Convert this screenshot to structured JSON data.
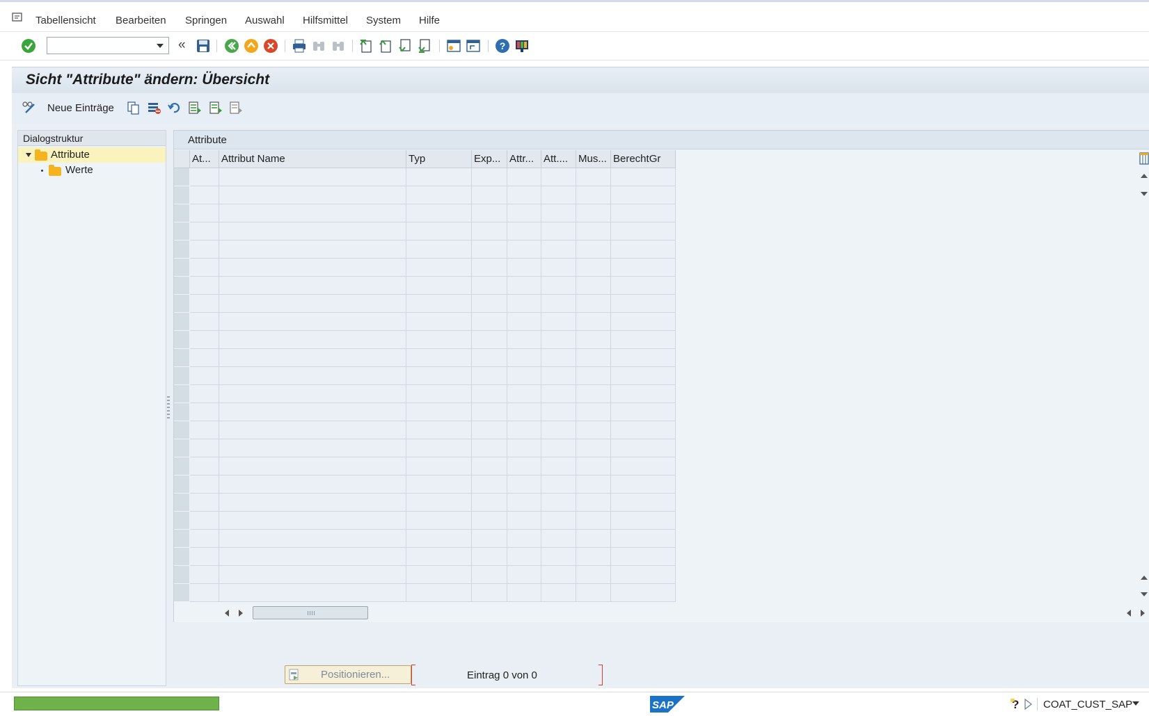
{
  "menu": {
    "items": [
      {
        "label": "Tabellensicht"
      },
      {
        "label": "Bearbeiten"
      },
      {
        "label": "Springen"
      },
      {
        "label": "Auswahl"
      },
      {
        "label": "Hilfsmittel"
      },
      {
        "label": "System"
      },
      {
        "label": "Hilfe"
      }
    ]
  },
  "toolbar": {
    "command_field_value": "",
    "icons": [
      "enter-icon",
      "save-icon",
      "back-icon",
      "exit-icon",
      "cancel-icon",
      "print-icon",
      "find-icon",
      "find-next-icon",
      "first-page-icon",
      "previous-page-icon",
      "next-page-icon",
      "last-page-icon",
      "create-session-icon",
      "shortcut-icon",
      "help-icon",
      "customize-layout-icon"
    ]
  },
  "title": "Sicht \"Attribute\" ändern: Übersicht",
  "app_toolbar": {
    "new_entries_label": "Neue Einträge"
  },
  "dialog_structure": {
    "header": "Dialogstruktur",
    "items": [
      {
        "label": "Attribute",
        "selected": true,
        "expanded": true
      },
      {
        "label": "Werte",
        "selected": false
      }
    ]
  },
  "table": {
    "caption": "Attribute",
    "columns": [
      "At...",
      "Attribut Name",
      "Typ",
      "Exp...",
      "Attr...",
      "Att....",
      "Mus...",
      "BerechtGr"
    ],
    "row_count": 24
  },
  "footer": {
    "position_label": "Positionieren...",
    "entry_count": "Eintrag 0 von 0"
  },
  "status": {
    "system": "COAT_CUST_SAP",
    "logo": "SAP"
  },
  "colors": {
    "accept": "#3aa53a",
    "progress": "#6db34a",
    "folder": "#f5b41f",
    "sap_blue": "#1a73c7"
  }
}
